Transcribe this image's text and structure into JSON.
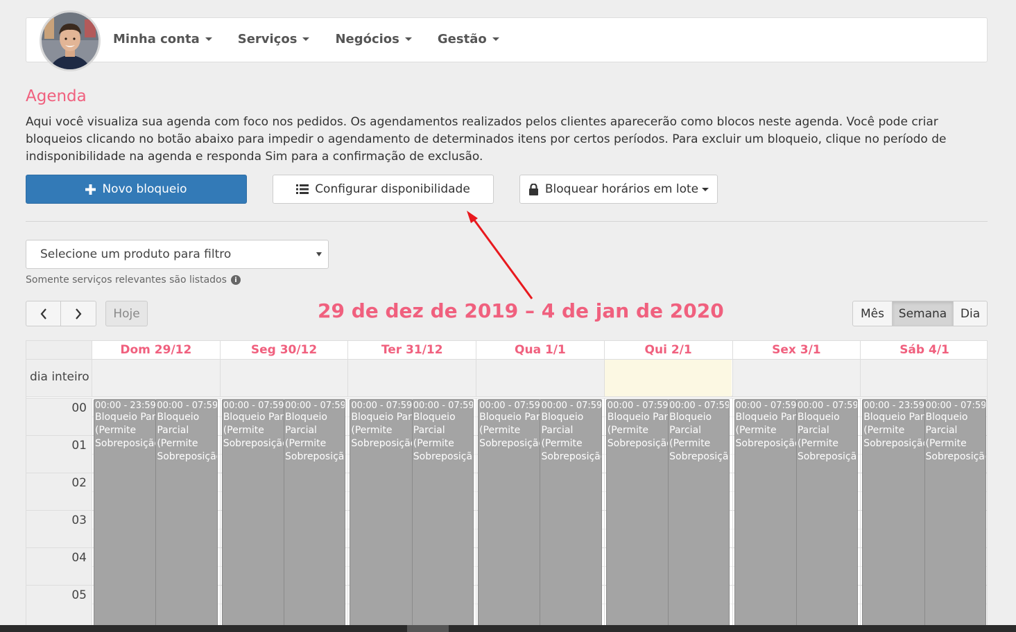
{
  "nav": {
    "items": [
      {
        "label": "Minha conta"
      },
      {
        "label": "Serviços"
      },
      {
        "label": "Negócios"
      },
      {
        "label": "Gestão"
      }
    ]
  },
  "page": {
    "title": "Agenda",
    "intro": "Aqui você visualiza sua agenda com foco nos pedidos. Os agendamentos realizados pelos clientes aparecerão como blocos neste agenda. Você pode criar bloqueios clicando no botão abaixo para impedir o agendamento de determinados itens por certos períodos. Para excluir um bloqueio, clique no período de indisponibilidade na agenda e responda Sim para a confirmação de exclusão."
  },
  "actions": {
    "new_block": "Novo bloqueio",
    "configure": "Configurar disponibilidade",
    "batch_block": "Bloquear horários em lote"
  },
  "filter": {
    "placeholder": "Selecione um produto para filtro",
    "help": "Somente serviços relevantes são listados"
  },
  "calendar": {
    "prev": "‹",
    "next": "›",
    "today": "Hoje",
    "range_title": "29 de dez de 2019 – 4 de jan de 2020",
    "views": {
      "month": "Mês",
      "week": "Semana",
      "day": "Dia"
    },
    "active_view": "week",
    "allday_label": "dia inteiro",
    "hours": [
      "00",
      "01",
      "02",
      "03",
      "04",
      "05"
    ],
    "days": [
      {
        "label": "Dom 29/12",
        "today": false,
        "events": [
          {
            "time": "00:00 - 23:59",
            "l1": "Bloqueio Parcial",
            "l2": "(Permite",
            "l3": "Sobreposição"
          },
          {
            "time": "00:00 - 07:59",
            "l1": "Bloqueio",
            "l2": "Parcial",
            "l3": "(Permite",
            "l4": "Sobreposição"
          }
        ]
      },
      {
        "label": "Seg 30/12",
        "today": false,
        "events": [
          {
            "time": "00:00 - 07:59",
            "l1": "Bloqueio Parcial",
            "l2": "(Permite",
            "l3": "Sobreposição"
          },
          {
            "time": "00:00 - 07:59",
            "l1": "Bloqueio",
            "l2": "Parcial",
            "l3": "(Permite",
            "l4": "Sobreposição"
          }
        ]
      },
      {
        "label": "Ter 31/12",
        "today": false,
        "events": [
          {
            "time": "00:00 - 07:59",
            "l1": "Bloqueio Parcial",
            "l2": "(Permite",
            "l3": "Sobreposição"
          },
          {
            "time": "00:00 - 07:59",
            "l1": "Bloqueio",
            "l2": "Parcial",
            "l3": "(Permite",
            "l4": "Sobreposição"
          }
        ]
      },
      {
        "label": "Qua 1/1",
        "today": false,
        "events": [
          {
            "time": "00:00 - 07:59",
            "l1": "Bloqueio Parcial",
            "l2": "(Permite",
            "l3": "Sobreposição"
          },
          {
            "time": "00:00 - 07:59",
            "l1": "Bloqueio",
            "l2": "Parcial",
            "l3": "(Permite",
            "l4": "Sobreposição"
          }
        ]
      },
      {
        "label": "Qui 2/1",
        "today": true,
        "events": [
          {
            "time": "00:00 - 07:59",
            "l1": "Bloqueio Parcial",
            "l2": "(Permite",
            "l3": "Sobreposição"
          },
          {
            "time": "00:00 - 07:59",
            "l1": "Bloqueio",
            "l2": "Parcial",
            "l3": "(Permite",
            "l4": "Sobreposição"
          }
        ]
      },
      {
        "label": "Sex 3/1",
        "today": false,
        "events": [
          {
            "time": "00:00 - 07:59",
            "l1": "Bloqueio Parcial",
            "l2": "(Permite",
            "l3": "Sobreposição"
          },
          {
            "time": "00:00 - 07:59",
            "l1": "Bloqueio",
            "l2": "Parcial",
            "l3": "(Permite",
            "l4": "Sobreposição"
          }
        ]
      },
      {
        "label": "Sáb 4/1",
        "today": false,
        "events": [
          {
            "time": "00:00 - 23:59",
            "l1": "Bloqueio Parcial",
            "l2": "(Permite",
            "l3": "Sobreposição"
          },
          {
            "time": "00:00 - 07:59",
            "l1": "Bloqueio",
            "l2": "Parcial",
            "l3": "(Permite",
            "l4": "Sobreposição"
          }
        ]
      }
    ]
  },
  "colors": {
    "accent": "#f0607e",
    "primary": "#337ab7",
    "today_bg": "#fcf8e3",
    "event_bg": "#a4a4a4",
    "annotation_arrow": "#e8191e"
  }
}
